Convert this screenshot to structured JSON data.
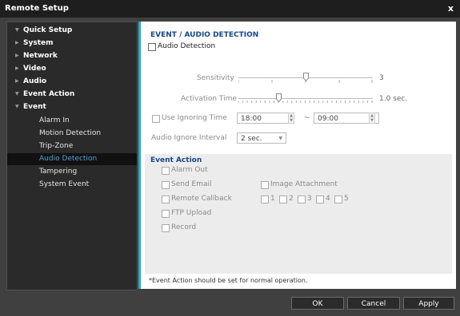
{
  "window": {
    "title": "Remote Setup",
    "close_glyph": "x"
  },
  "sidebar": {
    "items": [
      {
        "label": "Quick Setup",
        "arrow": "▼"
      },
      {
        "label": "System",
        "arrow": "▶"
      },
      {
        "label": "Network",
        "arrow": "▶"
      },
      {
        "label": "Video",
        "arrow": "▶"
      },
      {
        "label": "Audio",
        "arrow": "▶"
      },
      {
        "label": "Event Action",
        "arrow": "▼"
      },
      {
        "label": "Event",
        "arrow": "▼"
      }
    ],
    "event_children": [
      "Alarm In",
      "Motion Detection",
      "Trip-Zone",
      "Audio Detection",
      "Tampering",
      "System Event"
    ],
    "selected": "Audio Detection"
  },
  "main": {
    "section_title": "EVENT / AUDIO DETECTION",
    "audio_detection_label": "Audio Detection",
    "sensitivity": {
      "label": "Sensitivity",
      "value_text": "3",
      "value": 3,
      "min": 1,
      "max": 5
    },
    "activation_time": {
      "label": "Activation Time",
      "value_text": "1.0 sec.",
      "position": 0.3
    },
    "ignoring_time": {
      "label": "Use Ignoring Time",
      "start": "18:00",
      "separator": "~",
      "end": "09:00"
    },
    "audio_ignore_interval": {
      "label": "Audio Ignore Interval",
      "value": "2 sec."
    },
    "event_action": {
      "title": "Event Action",
      "alarm_out": "Alarm Out",
      "send_email": "Send Email",
      "image_attachment": "Image Attachment",
      "remote_callback": "Remote Callback",
      "callback_numbers": [
        "1",
        "2",
        "3",
        "4",
        "5"
      ],
      "ftp_upload": "FTP Upload",
      "record": "Record"
    },
    "note": "*Event Action should be set for normal operation."
  },
  "buttons": {
    "ok": "OK",
    "cancel": "Cancel",
    "apply": "Apply"
  },
  "colors": {
    "accent": "#28a9c6",
    "title_blue": "#17468a",
    "selected_text": "#4fa4d6"
  }
}
